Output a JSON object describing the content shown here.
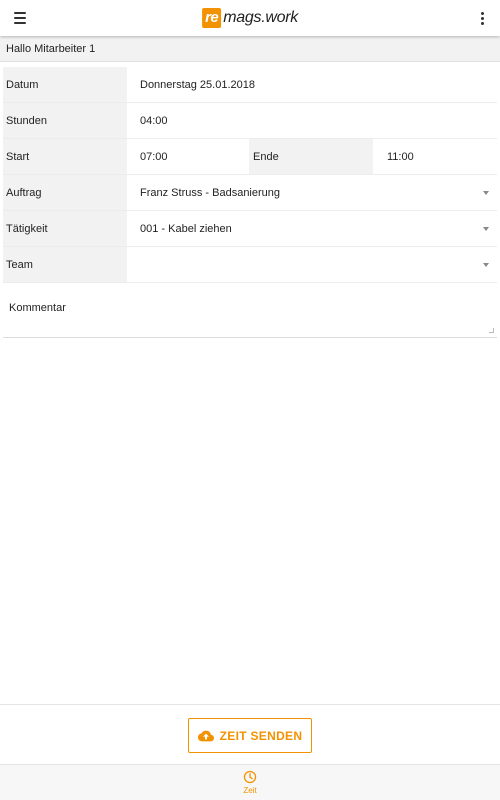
{
  "app": {
    "logo_prefix": "re",
    "logo_suffix": "mags.work",
    "accent_color": "#f39200"
  },
  "greeting": "Hallo Mitarbeiter 1",
  "form": {
    "datum": {
      "label": "Datum",
      "value": "Donnerstag 25.01.2018"
    },
    "stunden": {
      "label": "Stunden",
      "value": "04:00"
    },
    "start": {
      "label": "Start",
      "value": "07:00"
    },
    "ende": {
      "label": "Ende",
      "value": "11:00"
    },
    "auftrag": {
      "label": "Auftrag",
      "value": "Franz Struss - Badsanierung"
    },
    "taetigkeit": {
      "label": "Tätigkeit",
      "value": "001 - Kabel ziehen"
    },
    "team": {
      "label": "Team",
      "value": ""
    },
    "kommentar": {
      "placeholder": "Kommentar",
      "value": ""
    }
  },
  "actions": {
    "send_label": "ZEIT SENDEN",
    "send_icon": "cloud-upload-icon"
  },
  "bottom_nav": {
    "items": [
      {
        "label": "Zeit",
        "icon": "clock-icon",
        "active": true
      }
    ]
  }
}
